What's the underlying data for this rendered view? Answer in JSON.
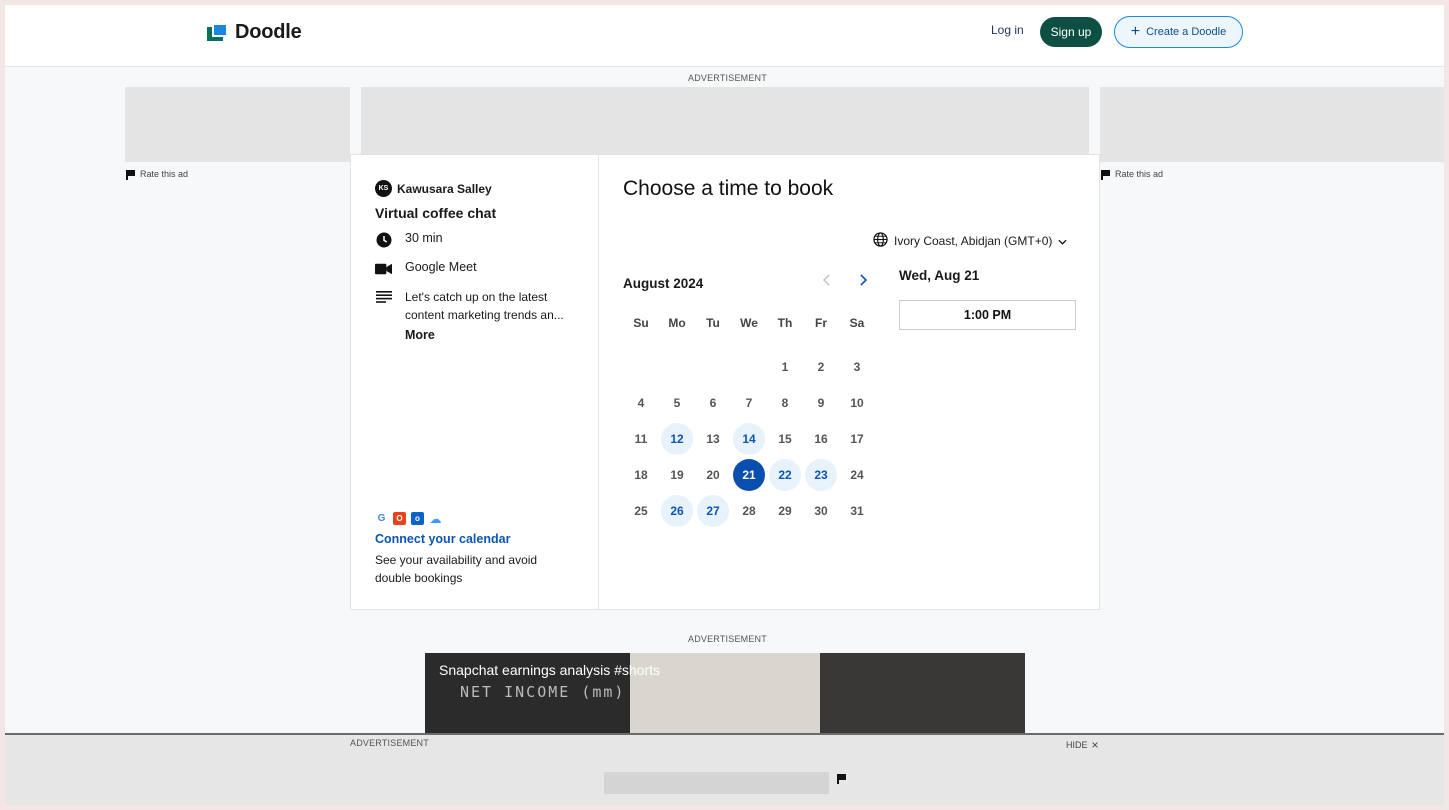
{
  "header": {
    "brand": "Doodle",
    "login": "Log in",
    "signup": "Sign up",
    "create": "Create a Doodle",
    "create_icon": "plus-icon"
  },
  "ads": {
    "top_label": "ADVERTISEMENT",
    "rate_left": "Rate this ad",
    "rate_right": "Rate this ad",
    "middle_label": "ADVERTISEMENT",
    "bottom_label": "ADVERTISEMENT",
    "hide": "HIDE"
  },
  "event": {
    "host_initials": "KS",
    "host_name": "Kawusara Salley",
    "title": "Virtual coffee chat",
    "duration": "30 min",
    "location": "Google Meet",
    "description": "Let's catch up on the latest content marketing trends an...",
    "more": "More",
    "connect": "Connect your calendar",
    "connect_desc": "See your availability and avoid double bookings"
  },
  "booking": {
    "title": "Choose a time to book",
    "timezone": "Ivory Coast, Abidjan (GMT+0)",
    "month": "August 2024",
    "weekdays": [
      "Su",
      "Mo",
      "Tu",
      "We",
      "Th",
      "Fr",
      "Sa"
    ],
    "first_weekday_index": 4,
    "days_in_month": 31,
    "available_days": [
      12,
      14,
      22,
      23,
      26,
      27
    ],
    "selected_day": 21,
    "selected_date_label": "Wed, Aug 21",
    "slots": [
      "1:00 PM"
    ]
  },
  "video": {
    "title": "Snapchat earnings analysis #shorts",
    "handwriting": "NET INCOME (mm)"
  },
  "colors": {
    "brand_green": "#0d4f43",
    "accent_blue": "#0a55b6",
    "selected_day": "#0a4fb0",
    "available_day_bg": "#e8f2fb"
  }
}
